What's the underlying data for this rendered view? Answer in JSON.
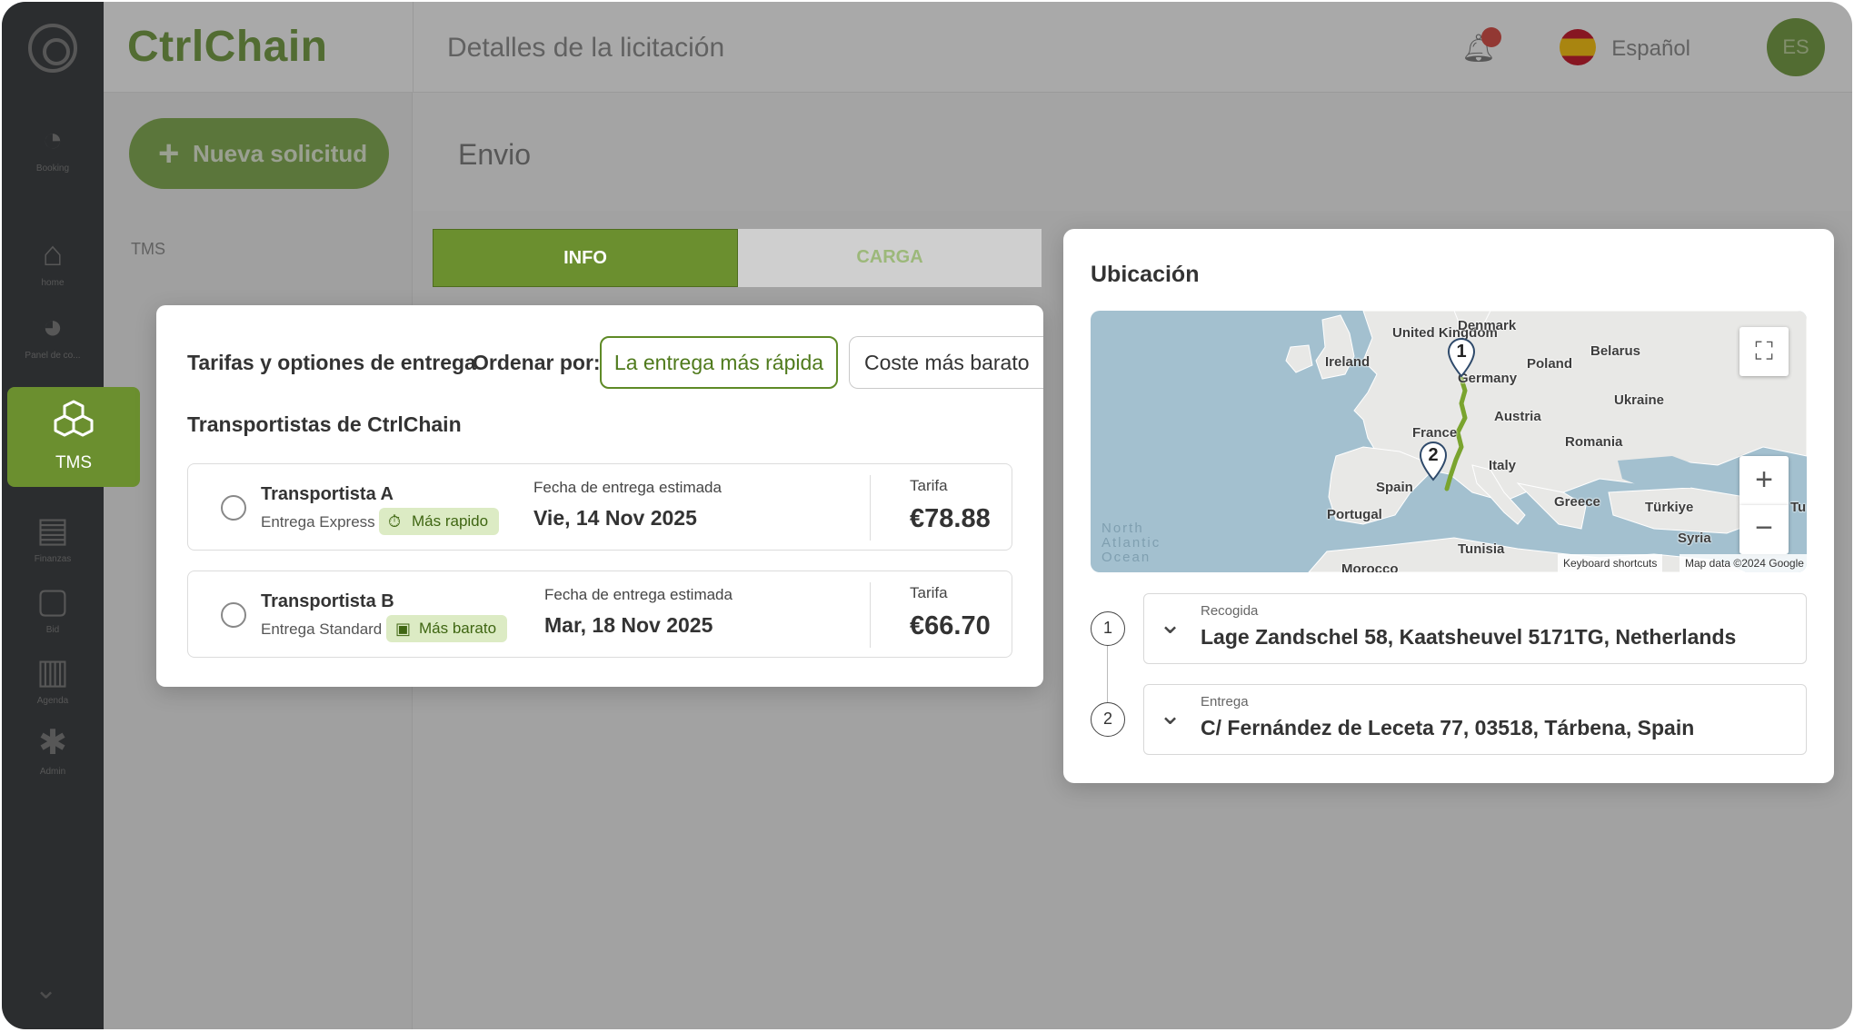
{
  "brand": "CtrlChain",
  "page_title": "Detalles de la licitación",
  "language": "Español",
  "user_initials": "ES",
  "sidebar": {
    "items": [
      {
        "label": "Booking"
      },
      {
        "label": "home"
      },
      {
        "label": "Panel de co..."
      },
      {
        "label": "TMS"
      },
      {
        "label": "Finanzas"
      },
      {
        "label": "Bid"
      },
      {
        "label": "Agenda"
      },
      {
        "label": "Admin"
      }
    ]
  },
  "left_panel": {
    "new_request": "Nueva solicitud",
    "section": "TMS"
  },
  "main": {
    "header": "Envio"
  },
  "tabs": [
    {
      "label": "INFO"
    },
    {
      "label": "CARGA"
    }
  ],
  "rates": {
    "title": "Tarifas y optiones de entrega",
    "sort_label": "Ordenar por:",
    "sort_options": [
      {
        "label": "La entrega más rápida"
      },
      {
        "label": "Coste más barato"
      }
    ],
    "carriers_title": "Transportistas de CtrlChain",
    "offers": [
      {
        "carrier": "Transportista A",
        "service": "Entrega Express",
        "badge": "Más rapido",
        "date_label": "Fecha de entrega estimada",
        "date": "Vie, 14 Nov 2025",
        "price_label": "Tarifa",
        "price": "€78.88"
      },
      {
        "carrier": "Transportista B",
        "service": "Entrega Standard",
        "badge": "Más barato",
        "date_label": "Fecha de entrega estimada",
        "date": "Mar, 18 Nov 2025",
        "price_label": "Tarifa",
        "price": "€66.70"
      }
    ]
  },
  "location": {
    "title": "Ubicación",
    "map": {
      "labels": [
        "United Kingdom",
        "Ireland",
        "Denmark",
        "Poland",
        "Belarus",
        "Germany",
        "Ukraine",
        "Austria",
        "France",
        "Romania",
        "Italy",
        "Spain",
        "Portugal",
        "Greece",
        "Türkiye",
        "Tunisia",
        "Syria",
        "Morocco",
        "Tu"
      ],
      "ocean_label": "North Atlantic Ocean",
      "markers": [
        "1",
        "2"
      ],
      "zoom_in": "+",
      "zoom_out": "−",
      "attribution_shortcuts": "Keyboard shortcuts",
      "attribution_data": "Map data ©2024 Google"
    },
    "stops": [
      {
        "number": "1",
        "label": "Recogida",
        "address": "Lage Zandschel 58, Kaatsheuvel 5171TG, Netherlands"
      },
      {
        "number": "2",
        "label": "Entrega",
        "address": "C/ Fernández de Leceta 77, 03518, Tárbena, Spain"
      }
    ]
  },
  "colors": {
    "accent": "#6b8f2f",
    "badge_bg": "#dcebc4",
    "route": "#7aa42e",
    "sidebar": "#2e3135"
  }
}
